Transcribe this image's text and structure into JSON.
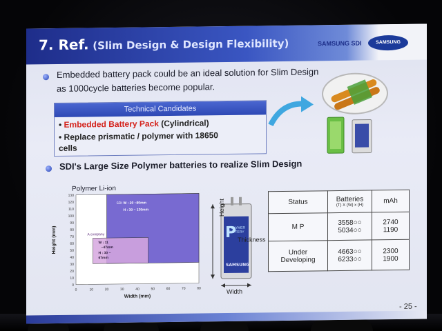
{
  "title": {
    "number": "7. Ref.",
    "subtitle": "(Slim Design & Design Flexibility)"
  },
  "brand": {
    "text": "SAMSUNG SDI",
    "logo": "SAMSUNG"
  },
  "bullets": {
    "first_line1": "Embedded battery pack could be an ideal solution for Slim Design",
    "first_line2": "as 1000cycle batteries become popular.",
    "second": "SDI's Large Size Polymer batteries to realize Slim Design"
  },
  "candidates": {
    "header": "Technical Candidates",
    "item1_red": "Embedded Battery Pack",
    "item1_rest": " (Cylindrical)",
    "item2_line1": "Replace prismatic / polymer with 18650",
    "item2_line2": "cells"
  },
  "chart_data": {
    "type": "area",
    "title": "Polymer Li-ion",
    "xlabel": "Width (mm)",
    "ylabel": "Height (mm)",
    "xlim": [
      0,
      80
    ],
    "ylim": [
      0,
      130
    ],
    "x_ticks": [
      0,
      10,
      20,
      30,
      40,
      50,
      60,
      70,
      80
    ],
    "y_ticks": [
      0,
      10,
      20,
      30,
      40,
      50,
      60,
      70,
      80,
      90,
      100,
      110,
      120,
      130
    ],
    "regions": [
      {
        "name": "SDI",
        "label1": "W : 20 ~80mm",
        "label2": "H : 30 ~ 130mm",
        "x": [
          20,
          80
        ],
        "y": [
          30,
          130
        ],
        "color": "#6a5acd"
      },
      {
        "name": "A company",
        "label1": "W : 11",
        "label2": "~47mm",
        "label3": "H : 30 ~",
        "label4": "67mm",
        "x": [
          11,
          47
        ],
        "y": [
          30,
          67
        ],
        "color": "#d6a7e0"
      }
    ]
  },
  "battery_image": {
    "height_label": "Height",
    "width_label": "Width",
    "thickness_label": "Thickness",
    "cell_text": "POLYMER BATTERY",
    "cell_letter": "P",
    "cell_brand": "SAMSUNG"
  },
  "spec_table": {
    "headers": {
      "status": "Status",
      "batteries": "Batteries",
      "batteries_sub": "(T) X (W) x (H)",
      "mah": "mAh"
    },
    "rows": [
      {
        "status": "M P",
        "batteries": [
          "3558○○",
          "5034○○"
        ],
        "mah": [
          "2740",
          "1190"
        ]
      },
      {
        "status_line1": "Under",
        "status_line2": "Developing",
        "batteries": [
          "4663○○",
          "6233○○"
        ],
        "mah": [
          "2300",
          "1900"
        ]
      }
    ]
  },
  "page": "- 25 -"
}
